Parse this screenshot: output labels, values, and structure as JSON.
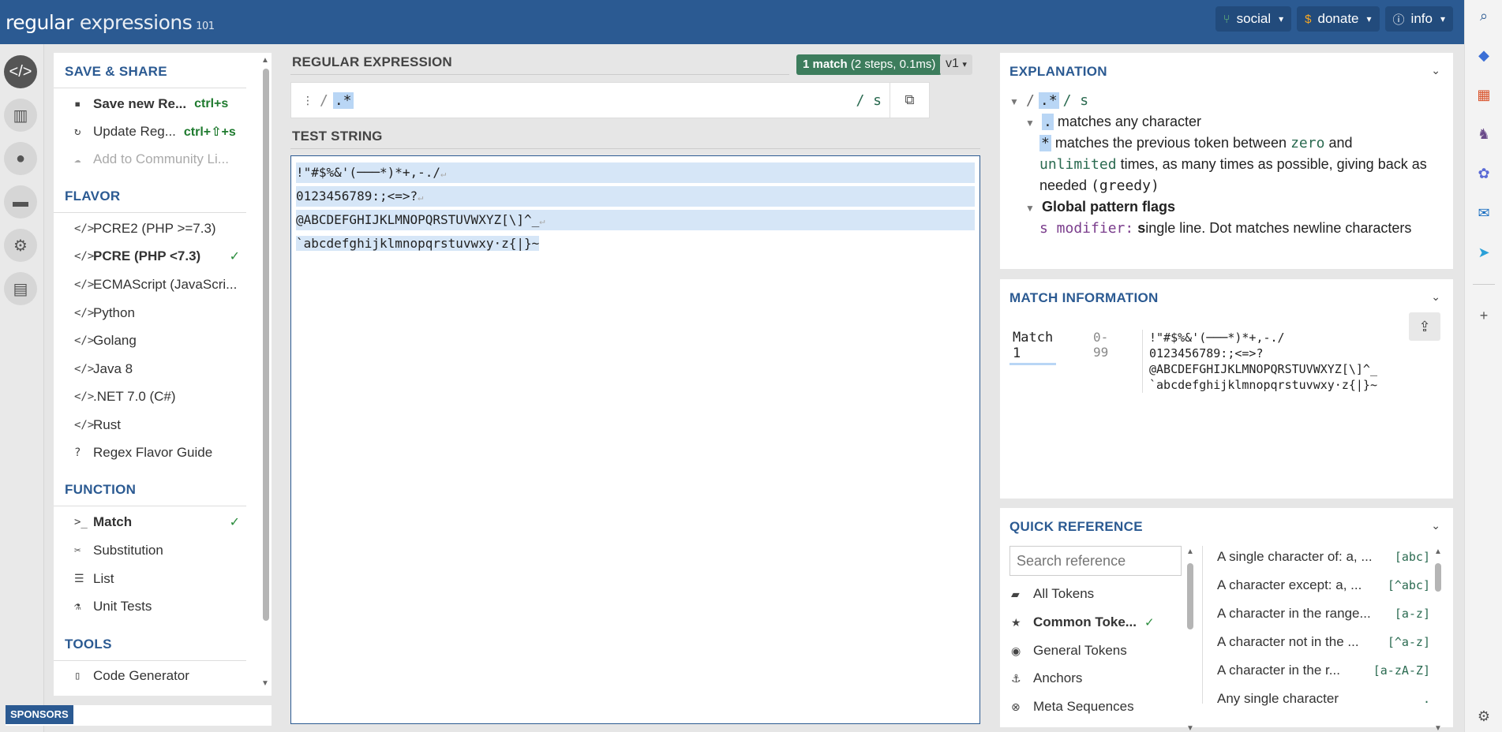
{
  "header": {
    "logo_main": "regular",
    "logo_second": "expressions",
    "logo_sup": "101",
    "buttons": [
      {
        "label": "social",
        "icon": "branch-icon"
      },
      {
        "label": "donate",
        "icon": "dollar-icon"
      },
      {
        "label": "info",
        "icon": "info-icon"
      }
    ]
  },
  "left": {
    "save_share": {
      "title": "SAVE & SHARE",
      "items": [
        {
          "label": "Save new Re...",
          "shortcut": "ctrl+s"
        },
        {
          "label": "Update Reg...",
          "shortcut": "ctrl+⇧+s"
        },
        {
          "label": "Add to Community Li..."
        }
      ]
    },
    "flavor": {
      "title": "FLAVOR",
      "items": [
        {
          "label": "PCRE2 (PHP >=7.3)"
        },
        {
          "label": "PCRE (PHP <7.3)"
        },
        {
          "label": "ECMAScript (JavaScri..."
        },
        {
          "label": "Python"
        },
        {
          "label": "Golang"
        },
        {
          "label": "Java 8"
        },
        {
          "label": ".NET 7.0 (C#)"
        },
        {
          "label": "Rust"
        },
        {
          "label": "Regex Flavor Guide"
        }
      ]
    },
    "function": {
      "title": "FUNCTION",
      "items": [
        {
          "label": "Match"
        },
        {
          "label": "Substitution"
        },
        {
          "label": "List"
        },
        {
          "label": "Unit Tests"
        }
      ]
    },
    "tools": {
      "title": "TOOLS",
      "items": [
        {
          "label": "Code Generator"
        }
      ]
    },
    "sponsors": "SPONSORS"
  },
  "center": {
    "regex_title": "REGULAR EXPRESSION",
    "match_badge_bold": "1 match",
    "match_badge_rest": " (2 steps, 0.1ms)",
    "version": "v1",
    "regex_open": "/",
    "regex": ".*",
    "regex_flags": "/ s",
    "test_title": "TEST STRING",
    "test_lines": [
      "!\"#$%&'(───*)*+,-./",
      "0123456789:;<=>?",
      "@ABCDEFGHIJKLMNOPQRSTUVWXYZ[\\]^_",
      "`abcdefghijklmnopqrstuvwxy·z{|}~"
    ]
  },
  "explanation": {
    "title": "EXPLANATION",
    "root_slash1": "/",
    "root_tok": ".*",
    "root_slash2": "/ s",
    "dot_tok": ".",
    "dot_desc": "matches any character",
    "star_tok": "*",
    "star_desc1": "matches the previous token between",
    "star_zero": "zero",
    "star_and": "and",
    "star_unlimited": "unlimited",
    "star_desc2": "times, as many times as possible, giving back as",
    "star_desc3": "needed",
    "star_greedy": "(greedy)",
    "flags_title": "Global pattern flags",
    "flag_name": "s modifier:",
    "flag_s": "s",
    "flag_desc": "ingle line. Dot matches newline characters"
  },
  "match_info": {
    "title": "MATCH INFORMATION",
    "label": "Match 1",
    "range": "0-99",
    "value": "!\"#$%&'(───*)*+,-./\n0123456789:;<=>?\n@ABCDEFGHIJKLMNOPQRSTUVWXYZ[\\]^_\n`abcdefghijklmnopqrstuvwxy·z{|}~"
  },
  "quick_ref": {
    "title": "QUICK REFERENCE",
    "search_placeholder": "Search reference",
    "categories": [
      {
        "label": "All Tokens"
      },
      {
        "label": "Common Toke..."
      },
      {
        "label": "General Tokens"
      },
      {
        "label": "Anchors"
      },
      {
        "label": "Meta Sequences"
      }
    ],
    "refs": [
      {
        "desc": "A single character of: a, ...",
        "code": "[abc]"
      },
      {
        "desc": "A character except: a, ...",
        "code": "[^abc]"
      },
      {
        "desc": "A character in the range...",
        "code": "[a-z]"
      },
      {
        "desc": "A character not in the ...",
        "code": "[^a-z]"
      },
      {
        "desc": "A character in the r...",
        "code": "[a-zA-Z]"
      },
      {
        "desc": "Any single character",
        "code": "."
      }
    ]
  }
}
